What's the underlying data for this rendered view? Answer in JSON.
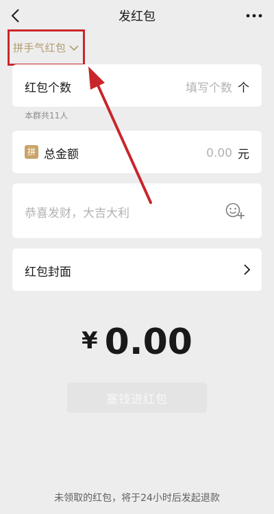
{
  "header": {
    "title": "发红包",
    "back_icon": "chevron-left-icon",
    "more_icon": "more-dots-icon"
  },
  "packet_type": {
    "label": "拼手气红包",
    "icon": "chevron-down-icon"
  },
  "count_row": {
    "label": "红包个数",
    "placeholder": "填写个数",
    "unit": "个",
    "hint": "本群共11人"
  },
  "amount_row": {
    "badge": "拼",
    "label": "总金额",
    "placeholder": "0.00",
    "unit": "元"
  },
  "greeting": {
    "placeholder": "恭喜发财，大吉大利",
    "icon": "emoji-add-icon"
  },
  "cover_row": {
    "label": "红包封面",
    "icon": "chevron-right-icon"
  },
  "total": {
    "currency": "¥",
    "value": "0.00"
  },
  "submit": {
    "label": "塞钱进红包"
  },
  "footer": {
    "note": "未领取的红包，将于24小时后发起退款"
  },
  "colors": {
    "accent_gold": "#b49a6d",
    "highlight_red": "#c8262a",
    "background": "#ededed"
  }
}
